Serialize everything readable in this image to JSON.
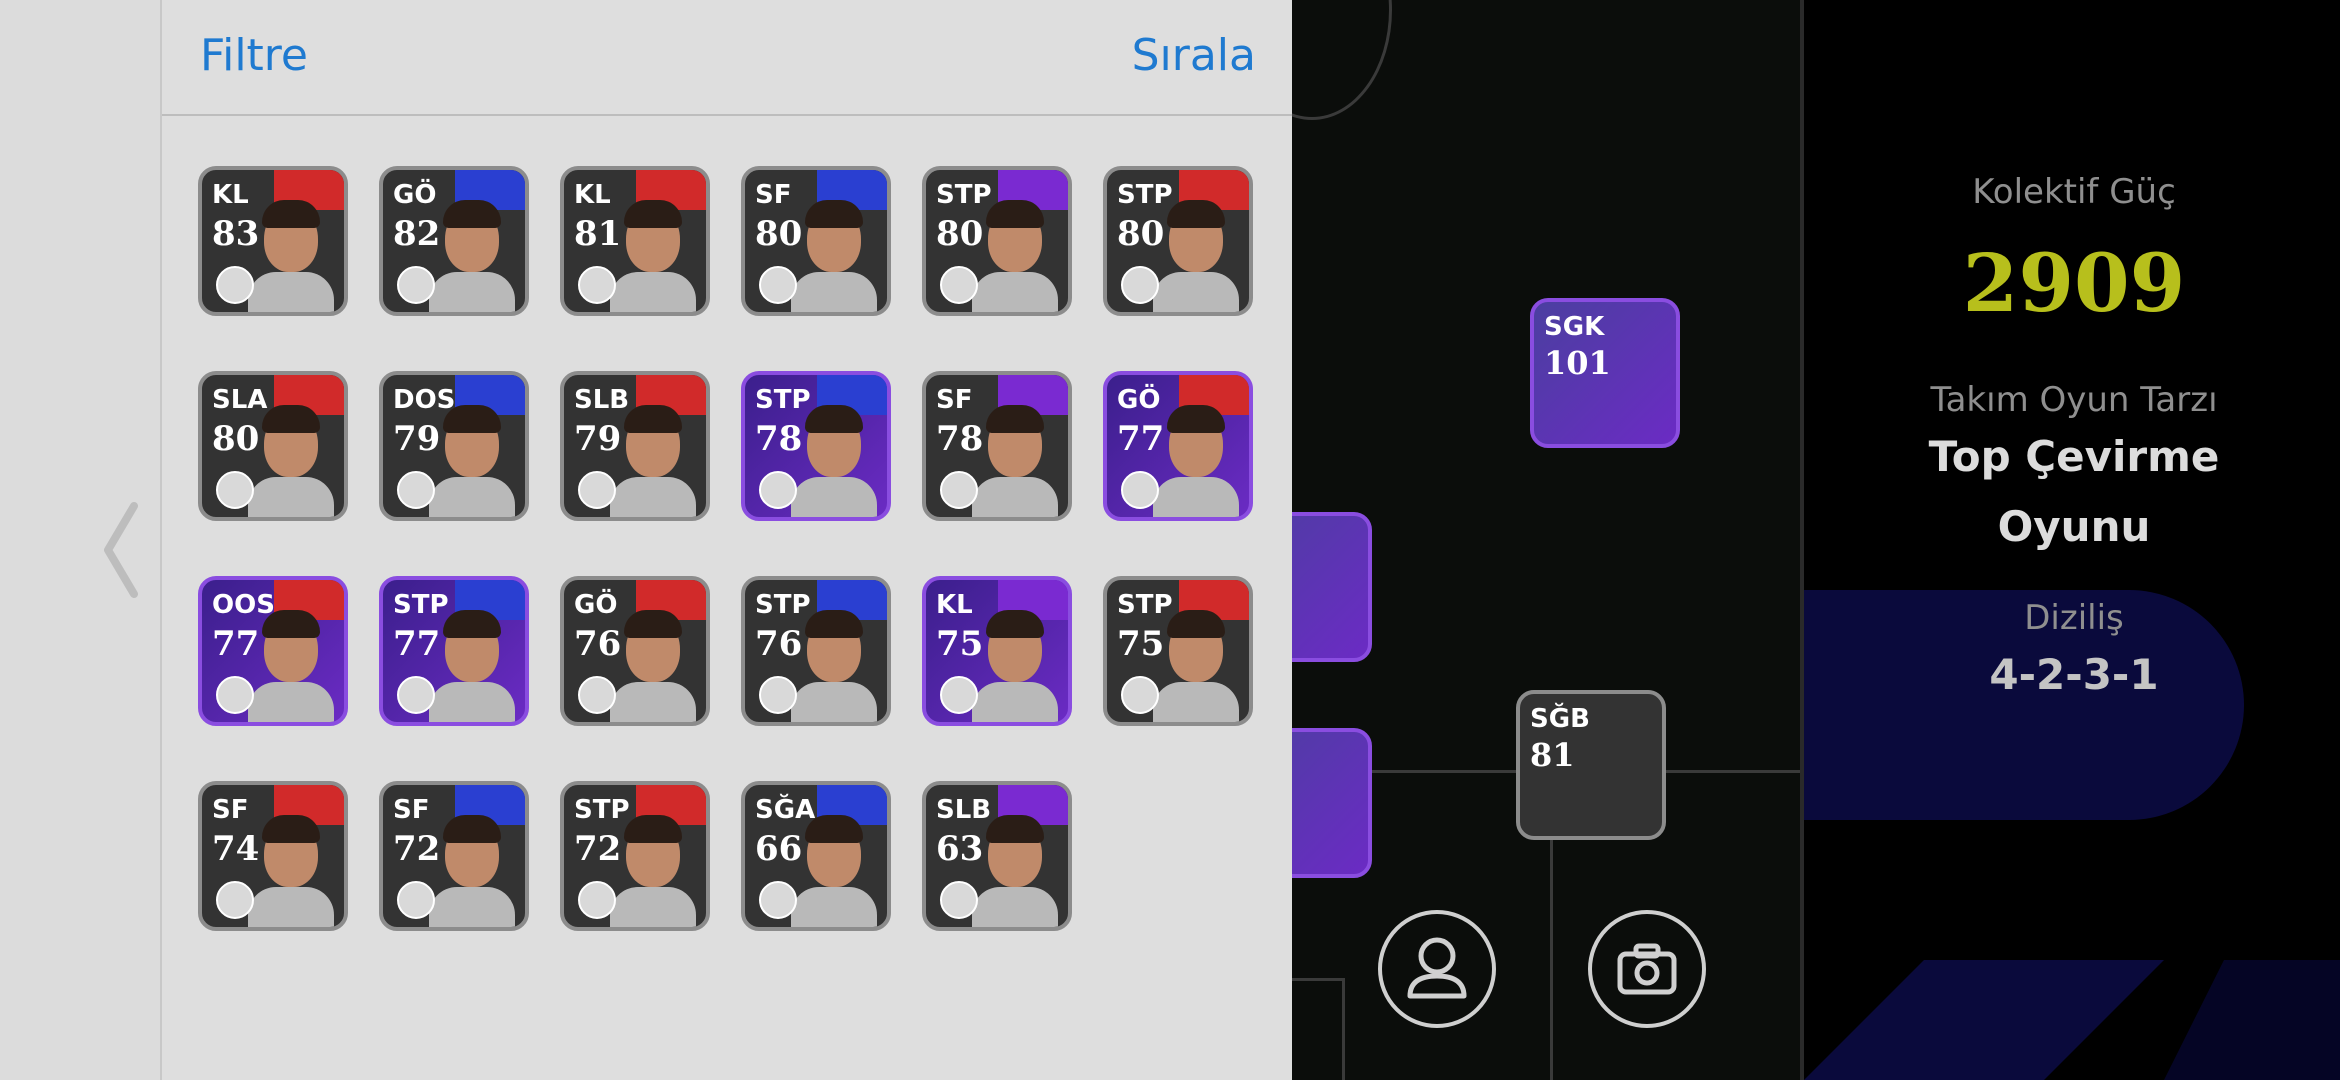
{
  "header": {
    "filter_label": "Filtre",
    "sort_label": "Sırala"
  },
  "players": [
    {
      "pos": "KL",
      "rating": "83",
      "style": "normal"
    },
    {
      "pos": "GÖ",
      "rating": "82",
      "style": "normal"
    },
    {
      "pos": "KL",
      "rating": "81",
      "style": "normal"
    },
    {
      "pos": "SF",
      "rating": "80",
      "style": "normal"
    },
    {
      "pos": "STP",
      "rating": "80",
      "style": "normal"
    },
    {
      "pos": "STP",
      "rating": "80",
      "style": "normal"
    },
    {
      "pos": "SLA",
      "rating": "80",
      "style": "normal"
    },
    {
      "pos": "DOS",
      "rating": "79",
      "style": "normal"
    },
    {
      "pos": "SLB",
      "rating": "79",
      "style": "normal"
    },
    {
      "pos": "STP",
      "rating": "78",
      "style": "purple"
    },
    {
      "pos": "SF",
      "rating": "78",
      "style": "normal"
    },
    {
      "pos": "GÖ",
      "rating": "77",
      "style": "purple"
    },
    {
      "pos": "OOS",
      "rating": "77",
      "style": "purple"
    },
    {
      "pos": "STP",
      "rating": "77",
      "style": "purple"
    },
    {
      "pos": "GÖ",
      "rating": "76",
      "style": "normal"
    },
    {
      "pos": "STP",
      "rating": "76",
      "style": "normal"
    },
    {
      "pos": "KL",
      "rating": "75",
      "style": "purple"
    },
    {
      "pos": "STP",
      "rating": "75",
      "style": "normal"
    },
    {
      "pos": "SF",
      "rating": "74",
      "style": "normal"
    },
    {
      "pos": "SF",
      "rating": "72",
      "style": "normal"
    },
    {
      "pos": "STP",
      "rating": "72",
      "style": "normal"
    },
    {
      "pos": "SĞA",
      "rating": "66",
      "style": "normal"
    },
    {
      "pos": "SLB",
      "rating": "63",
      "style": "normal"
    }
  ],
  "field_cards": [
    {
      "pos": "SGK",
      "rating": "101",
      "style": "purple"
    },
    {
      "pos": "SĞB",
      "rating": "81",
      "style": "normal"
    }
  ],
  "info": {
    "team_strength_label": "Kolektif Güç",
    "team_strength_value": "2909",
    "play_style_label": "Takım Oyun Tarzı",
    "play_style_line1": "Top Çevirme",
    "play_style_line2": "Oyunu",
    "formation_label": "Diziliş",
    "formation_value": "4-2-3-1"
  },
  "colors": {
    "accent_blue": "#1f7ad0",
    "strength_yellow": "#b7bf1c",
    "panel_gray": "#dedede",
    "card_purple": "#6b2bc4"
  },
  "icons": [
    "chevron-left-icon",
    "person-icon",
    "camera-icon"
  ]
}
